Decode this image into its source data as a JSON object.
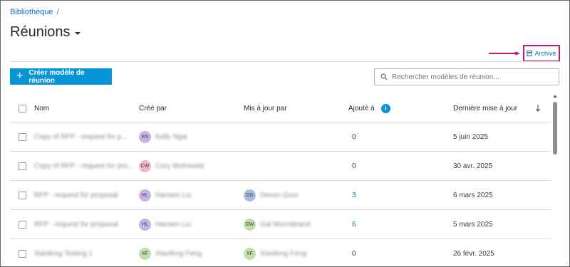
{
  "breadcrumb": {
    "root": "Bibliothèque",
    "separator": "/"
  },
  "page": {
    "title": "Réunions"
  },
  "toolbar": {
    "archive_label": "Archivé",
    "create_label": "Créer modèle de réunion",
    "search_placeholder": "Rechercher modèles de réunion..."
  },
  "colors": {
    "accent": "#0696d7",
    "link": "#0e6fb8",
    "highlight": "#b11f7a"
  },
  "table": {
    "columns": {
      "name": "Nom",
      "created_by": "Créé par",
      "updated_by": "Mis à jour par",
      "added_to": "Ajouté à",
      "last_update": "Dernière mise à jour"
    },
    "rows": [
      {
        "name": "Copy of RFP - request for p...",
        "creator_initials": "KN",
        "creator_name": "Kelly Ngai",
        "creator_color": "#c9b3e6",
        "updater_initials": "",
        "updater_name": "",
        "updater_color": "",
        "added": "0",
        "date": "5 juin 2025"
      },
      {
        "name": "Copy of RFP - request for pro...",
        "creator_initials": "CW",
        "creator_name": "Cory Wolnewitz",
        "creator_color": "#f4b6c8",
        "updater_initials": "",
        "updater_name": "",
        "updater_color": "",
        "added": "0",
        "date": "30 avr. 2025"
      },
      {
        "name": "RFP - request for proposal",
        "creator_initials": "HL",
        "creator_name": "Hansen Liu",
        "creator_color": "#c9b3e6",
        "updater_initials": "DG",
        "updater_name": "Devon Gour",
        "updater_color": "#a9bde0",
        "added": "3",
        "date": "6 mars 2025"
      },
      {
        "name": "RFP - request for proposal",
        "creator_initials": "HL",
        "creator_name": "Hansen Liu",
        "creator_color": "#c9b3e6",
        "updater_initials": "GW",
        "updater_name": "Gal Wurmbrand",
        "updater_color": "#bfe0a8",
        "added": "6",
        "date": "5 mars 2025"
      },
      {
        "name": "Xiaofeng Testing 1",
        "creator_initials": "XF",
        "creator_name": "Xiaofeng Feng",
        "creator_color": "#bfe0a8",
        "updater_initials": "XF",
        "updater_name": "Xiaofeng Feng",
        "updater_color": "#bfe0a8",
        "added": "0",
        "date": "26 févr. 2025"
      }
    ]
  },
  "icons": {
    "archive": "archive-icon",
    "search": "search-icon",
    "info": "info-icon",
    "sort": "sort-down-arrow-icon",
    "dropdown": "caret-down-icon"
  }
}
